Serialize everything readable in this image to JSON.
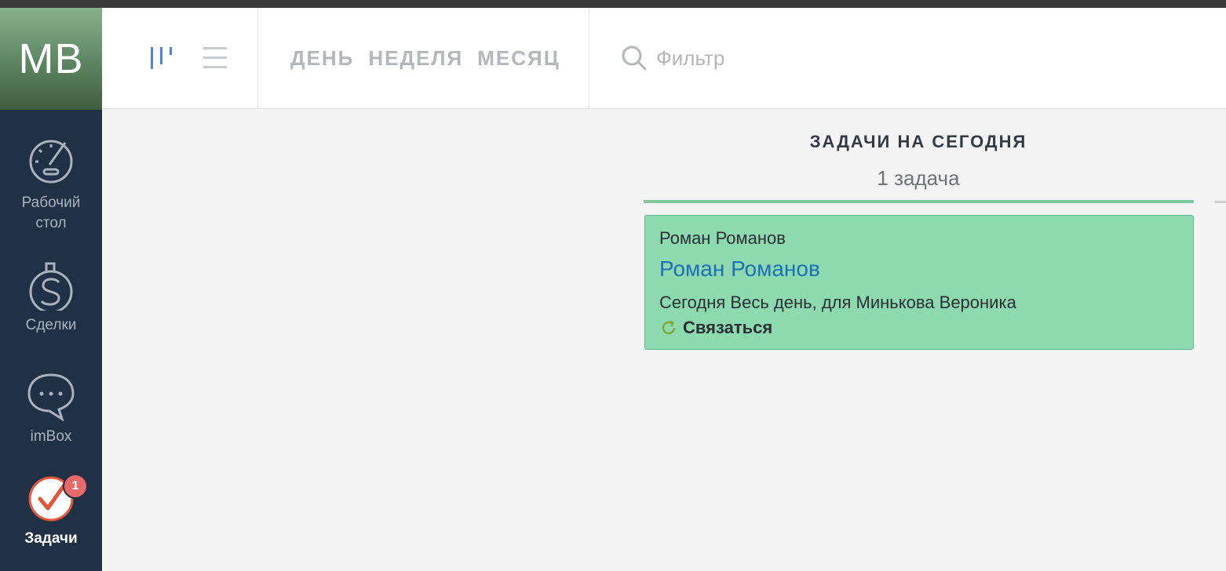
{
  "user": {
    "initials": "MB"
  },
  "sidebar": {
    "items": [
      {
        "label": "Рабочий\nстол",
        "icon": "dashboard-gauge-icon",
        "active": false
      },
      {
        "label": "Сделки",
        "icon": "dollar-icon",
        "active": false
      },
      {
        "label": "imBox",
        "icon": "chat-bubble-icon",
        "active": false
      },
      {
        "label": "Задачи",
        "icon": "tasks-check-icon",
        "active": true,
        "badge": "1"
      }
    ]
  },
  "header": {
    "view_modes": [
      "board-view-icon",
      "list-view-icon"
    ],
    "periods": [
      "ДЕНЬ",
      "НЕДЕЛЯ",
      "МЕСЯЦ"
    ],
    "filter_placeholder": "Фильтр"
  },
  "column": {
    "title": "ЗАДАЧИ НА СЕГОДНЯ",
    "count": "1 задача",
    "accent": "#85c89e"
  },
  "task": {
    "contact": "Роман Романов",
    "lead": "Роман Романов",
    "when": "Сегодня Весь день, для Минькова Вероника",
    "type": "Связаться",
    "bg": "#8dd9b0"
  }
}
